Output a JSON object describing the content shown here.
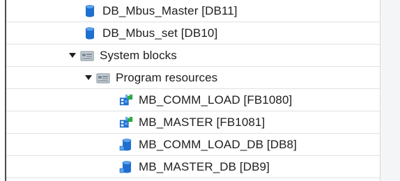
{
  "tree": {
    "items": [
      {
        "label": "DB_Mbus_Master [DB11]",
        "icon": "data-block-icon",
        "level": 2,
        "expanded": null
      },
      {
        "label": "DB_Mbus_set [DB10]",
        "icon": "data-block-icon",
        "level": 2,
        "expanded": null
      },
      {
        "label": "System blocks",
        "icon": "folder-icon",
        "level": 1,
        "expanded": true
      },
      {
        "label": "Program resources",
        "icon": "folder-icon",
        "level": 2,
        "expanded": true
      },
      {
        "label": "MB_COMM_LOAD [FB1080]",
        "icon": "function-block-icon",
        "level": 3,
        "expanded": null
      },
      {
        "label": "MB_MASTER [FB1081]",
        "icon": "function-block-icon",
        "level": 3,
        "expanded": null
      },
      {
        "label": "MB_COMM_LOAD_DB [DB8]",
        "icon": "instance-db-icon",
        "level": 3,
        "expanded": null
      },
      {
        "label": "MB_MASTER_DB [DB9]",
        "icon": "instance-db-icon",
        "level": 3,
        "expanded": null
      }
    ]
  },
  "colors": {
    "db_blue": "#1f6fd0",
    "folder_grey": "#7f8b96",
    "row_divider": "#dde0e3"
  }
}
